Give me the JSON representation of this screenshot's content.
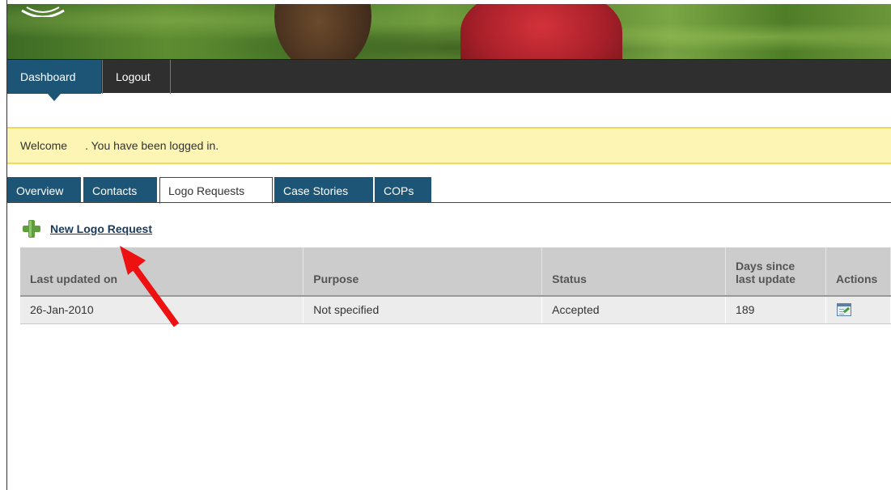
{
  "nav": {
    "dashboard": "Dashboard",
    "logout": "Logout"
  },
  "welcome": {
    "prefix": "Welcome",
    "suffix": ". You have been logged in."
  },
  "tabs": [
    {
      "label": "Overview",
      "active": false
    },
    {
      "label": "Contacts",
      "active": false
    },
    {
      "label": "Logo Requests",
      "active": true
    },
    {
      "label": "Case Stories",
      "active": false
    },
    {
      "label": "COPs",
      "active": false
    }
  ],
  "new_request": {
    "label": "New Logo Request",
    "icon": "plus-icon"
  },
  "table": {
    "headers": [
      "Last updated on",
      "Purpose",
      "Status",
      "Days since last update",
      "Actions"
    ],
    "rows": [
      {
        "last_updated": "26-Jan-2010",
        "purpose": "Not specified",
        "status": "Accepted",
        "days": "189",
        "action_icon": "edit-icon"
      }
    ]
  },
  "colors": {
    "nav_active": "#1d5577",
    "nav_bg": "#2f2f2f",
    "welcome_bg": "#fdf5b3",
    "welcome_border": "#f1d85a",
    "annotation_arrow": "#ee1111"
  }
}
